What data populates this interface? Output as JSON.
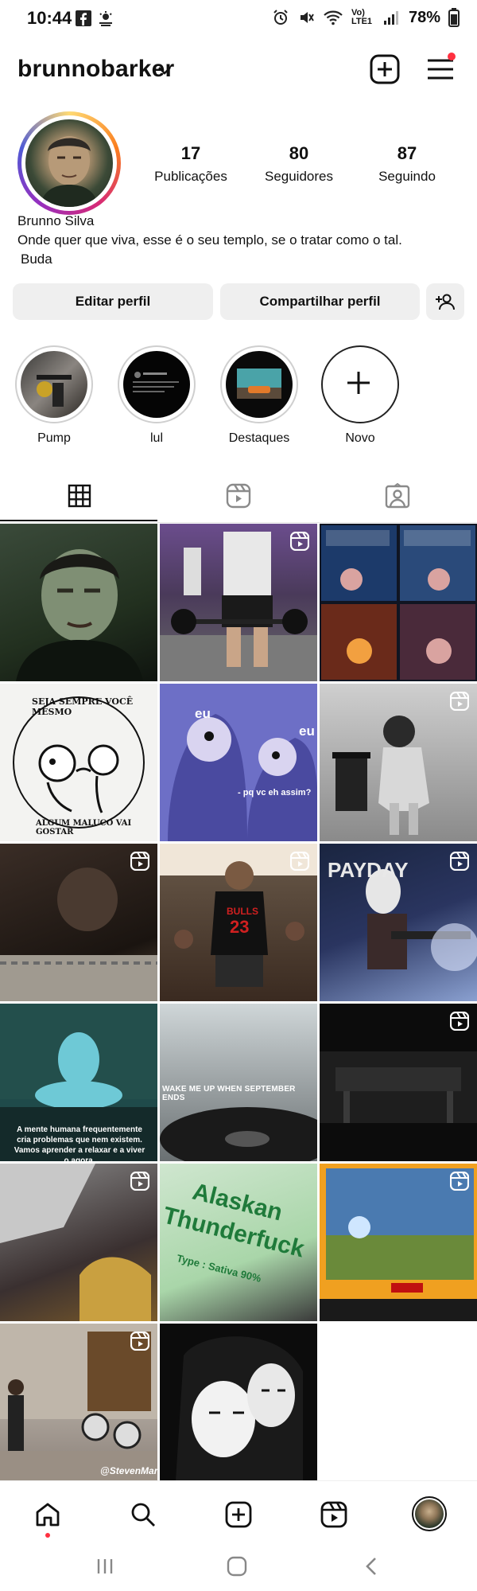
{
  "status_bar": {
    "time": "10:44",
    "network": "Vo) LTE1",
    "battery": "78%"
  },
  "header": {
    "username": "brunnobarker"
  },
  "profile": {
    "stats": [
      {
        "value": "17",
        "label": "Publicações"
      },
      {
        "value": "80",
        "label": "Seguidores"
      },
      {
        "value": "87",
        "label": "Seguindo"
      }
    ],
    "display_name": "Brunno Silva",
    "bio_line1": "Onde quer que viva, esse é o seu templo, se o tratar como o tal.",
    "bio_line2": "Buda"
  },
  "actions": {
    "edit": "Editar perfil",
    "share": "Compartilhar perfil"
  },
  "highlights": [
    {
      "label": "Pump"
    },
    {
      "label": "lul"
    },
    {
      "label": "Destaques"
    },
    {
      "label": "Novo"
    }
  ],
  "grid": {
    "c4_top": "SEJA SEMPRE VOCÊ MESMO",
    "c4_bottom": "ALGUM MALUCO VAI GOSTAR",
    "c5_a": "eu",
    "c5_b": "eu",
    "c5_caption": "- pq vc eh assim?",
    "c8_jersey_team": "BULLS",
    "c8_jersey_number": "23",
    "c9_title": "PAYDAY",
    "c10_text": "A mente humana frequentemente cria problemas que nem existem. Vamos aprender a relaxar e a viver o agora.",
    "c11_text": "WAKE ME UP WHEN SEPTEMBER ENDS",
    "c14_line1": "Alaskan",
    "c14_line2": "Thunderfuck",
    "c14_line3": "Type : Sativa 90%",
    "c16_watermark": "@StevenMarl"
  },
  "colors": {
    "accent_red": "#ff3040",
    "button_bg": "#efefef",
    "text": "#111111"
  }
}
